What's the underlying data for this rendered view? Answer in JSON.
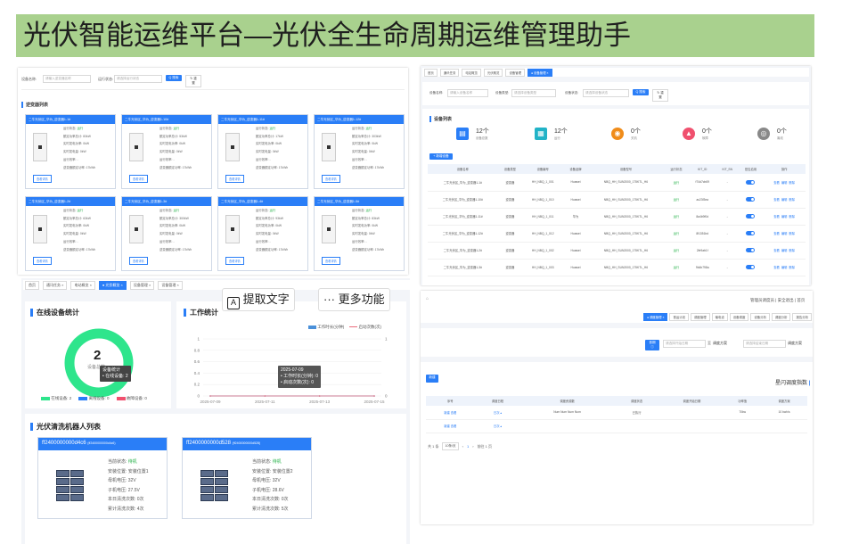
{
  "title": "光伏智能运维平台—光伏全生命周期运维管理助手",
  "overlay": {
    "extract_text": "提取文字",
    "more": "更多功能"
  },
  "s1": {
    "device_name_label": "设备名称:",
    "device_name_ph": "请输入逆变器名称",
    "status_label": "运行状态:",
    "status_ph": "请选择运行状态",
    "search": "Q 搜索",
    "reset": "↻ 重置",
    "section": "逆变器列表",
    "cards": [
      {
        "name": "二牛光伏区_华为_逆变器1-1#",
        "status": "运行",
        "v1": "83kW",
        "v2": "0kW",
        "v3": "-",
        "v4": "17kWh"
      },
      {
        "name": "二牛光伏区_华为_逆变器1-10#",
        "status": "运行",
        "v1": "53kW",
        "v2": "0kW",
        "v3": "-",
        "v4": "17kWh"
      },
      {
        "name": "二牛光伏区_华为_逆变器1-11#",
        "status": "运行",
        "v1": "17kW",
        "v2": "0kW",
        "v3": "-",
        "v4": "17kWh"
      },
      {
        "name": "二牛光伏区_华为_逆变器1-12#",
        "status": "运行",
        "v1": "303kW",
        "v2": "0kW",
        "v3": "-",
        "v4": "17kWh"
      },
      {
        "name": "二牛光伏区_华为_逆变器1-2#",
        "status": "运行",
        "v1": "63kW",
        "v2": "0kW",
        "v3": "-",
        "v4": "17kWh"
      },
      {
        "name": "二牛光伏区_华为_逆变器1-3#",
        "status": "运行",
        "v1": "300kW",
        "v2": "0kW",
        "v3": "-",
        "v4": "17kWh"
      },
      {
        "name": "二牛光伏区_华为_逆变器1-4#",
        "status": "运行",
        "v1": "93kW",
        "v2": "0kW",
        "v3": "-",
        "v4": "17kWh"
      },
      {
        "name": "二牛光伏区_华为_逆变器1-5#",
        "status": "运行",
        "v1": "83kW",
        "v2": "0kW",
        "v3": "-",
        "v4": "17kWh"
      }
    ],
    "kv_labels": [
      "运行状态:",
      "额定功率总计:",
      "实时发电功率:",
      "实时发电量:",
      "运行效率:",
      "逆变器额定功率:"
    ],
    "detail_btn": "查看详情"
  },
  "s2": {
    "tabs": [
      "首页",
      "通讯任务 ×",
      "电站概览 ×",
      "● 光伏概览 ×",
      "设备管理 ×",
      "设备管理 ×"
    ],
    "online_title": "在线设备统计",
    "online_count": "2",
    "online_sub": "设备总数",
    "tooltip_title": "设备统计",
    "tooltip_line": "• 在线设备: 2",
    "legend": [
      "在线设备: 2",
      "离线设备: 0",
      "故障设备: 0"
    ],
    "work_title": "工作统计",
    "work_legend1": "工作时长(分钟)",
    "work_legend2": "启动次数(次)",
    "work_tt_date": "2025-07-09",
    "work_tt_l1": "• 工作时长(分钟): 0",
    "work_tt_l2": "• 启动次数(次): 0",
    "robot_title": "光伏清洗机器人列表",
    "robots": [
      {
        "id": "ff2400000000d4c6",
        "sub": "(ff2400000000d4c6)",
        "status": "待机",
        "loc": "安装位置1",
        "bus": "32V",
        "sub_v": "27.5V",
        "wash_today": "0次",
        "wash_total": "4次"
      },
      {
        "id": "ff2400000000d528",
        "sub": "(ff2400000000d528)",
        "status": "待机",
        "loc": "安装位置2",
        "bus": "32V",
        "sub_v": "28.6V",
        "wash_today": "0次",
        "wash_total": "5次"
      }
    ],
    "robot_labels": [
      "当前状态:",
      "安装位置:",
      "母机电压:",
      "子机电压:",
      "本日清洗次数:",
      "累计清洗次数:"
    ]
  },
  "work_chart": {
    "chart_data": {
      "type": "line",
      "x": [
        "2025-07-09",
        "2025-07-11",
        "2025-07-13",
        "2025-07-15"
      ],
      "y_left_ticks": [
        "0",
        "0.2",
        "0.4",
        "0.6",
        "0.8",
        "1"
      ],
      "y_right_ticks": [
        "0",
        "1"
      ],
      "series": [
        {
          "name": "工作时长(分钟)",
          "values": [
            0,
            0,
            0,
            0
          ]
        },
        {
          "name": "启动次数(次)",
          "values": [
            0,
            0,
            0,
            0
          ]
        }
      ],
      "ylim": [
        0,
        1
      ]
    }
  },
  "s3": {
    "crumbs": [
      "首页",
      "通讯任务",
      "电站概览",
      "光伏概览",
      "设备管理",
      "● 设备管理 ×"
    ],
    "name_label": "设备名称:",
    "name_ph": "请输入设备名称",
    "type_label": "设备类型:",
    "type_ph": "请选择设备类型",
    "status_label": "设备状态:",
    "status_ph": "请选择设备状态",
    "search": "Q 搜索",
    "reset": "↻ 重置",
    "section": "设备列表",
    "stats": [
      {
        "n": "12个",
        "t": "设备总数",
        "color": "#2a7ef7",
        "icon": "▤"
      },
      {
        "n": "12个",
        "t": "运行",
        "color": "#21b3c7",
        "icon": "▦"
      },
      {
        "n": "0个",
        "t": "关机",
        "color": "#f08c1a",
        "icon": "◉"
      },
      {
        "n": "0个",
        "t": "故障",
        "color": "#f0506e",
        "icon": "▲"
      },
      {
        "n": "0个",
        "t": "离线",
        "color": "#888888",
        "icon": "◎"
      }
    ],
    "add_btn": "+ 新增设备",
    "headers": [
      "设备名称",
      "设备类型",
      "设备编号",
      "设备品牌",
      "设备型号",
      "运行状态",
      "KIT_ID",
      "KIT_SN",
      "是否启用",
      "操作"
    ],
    "rows": [
      [
        "二牛光伏区_华为_逆变器1-1#",
        "逆变器",
        "HH_NBQ_1_001",
        "Huawei",
        "NBQ_HH_SUN2000_175KTL_H6",
        "运行",
        "f74d7cb69",
        "-",
        "",
        "查看 编辑 删除"
      ],
      [
        "二牛光伏区_华为_逆变器1-10#",
        "逆变器",
        "HH_NBQ_1_010",
        "Huawei",
        "NBQ_HH_SUN2000_175KTL_H6",
        "运行",
        "ac23f3ea",
        "-",
        "",
        "查看 编辑 删除"
      ],
      [
        "二牛光伏区_华为_逆变器1-11#",
        "逆变器",
        "HH_NBQ_1_011",
        "华为",
        "NBQ_HH_SUN2000_175KTL_H6",
        "运行",
        "8a4b9f0d",
        "-",
        "",
        "查看 编辑 删除"
      ],
      [
        "二牛光伏区_华为_逆变器1-12#",
        "逆变器",
        "HH_NBQ_1_012",
        "Huawei",
        "NBQ_HH_SUN2000_175KTL_H6",
        "运行",
        "8f1351bd",
        "-",
        "",
        "查看 编辑 删除"
      ],
      [
        "二牛光伏区_华为_逆变器1-2#",
        "逆变器",
        "HH_NBQ_1_002",
        "Huawei",
        "NBQ_HH_SUN2000_175KTL_H6",
        "运行",
        "2fe9ab1f",
        "-",
        "",
        "查看 编辑 删除"
      ],
      [
        "二牛光伏区_华为_逆变器1-3#",
        "逆变器",
        "HH_NBQ_1_003",
        "Huawei",
        "NBQ_HH_SUN2000_175KTL_H6",
        "运行",
        "9b4b798a",
        "-",
        "",
        "查看 编辑 删除"
      ]
    ],
    "actions": [
      "查看",
      "编辑",
      "删除"
    ]
  },
  "s4": {
    "top_right": "管理员调度员 | 安全退出 | 首页",
    "tabs": [
      "● 调度管理 ×",
      "首运计划",
      "调度管理",
      "输电设",
      "设备调度",
      "设备分析",
      "调度分析",
      "报告分析",
      "首页"
    ],
    "date_btn": "首期 ⓘ",
    "date_ph": "请选择开始日期",
    "to": "至",
    "date_ph2": "请选择结束日期",
    "btn_mid": "调度方案",
    "section": "新建",
    "right_title": "星闪调度指数",
    "headers": [
      "序号",
      "调度日程",
      "调度资源数",
      "调度状态",
      "调度开始日期",
      "功率值",
      "调度方案"
    ],
    "rows": [
      [
        "新建 查看",
        "日次 ▴",
        "Num Num Num Num",
        "已执行",
        "",
        "70kw",
        "10 kwh/s"
      ],
      [
        "新建 查看",
        "日次 ▴",
        "",
        "",
        "",
        "",
        ""
      ]
    ],
    "pager": {
      "total": "共 1 条",
      "page": "1",
      "size": "10条/页",
      "goto": "前往 1 页"
    }
  }
}
